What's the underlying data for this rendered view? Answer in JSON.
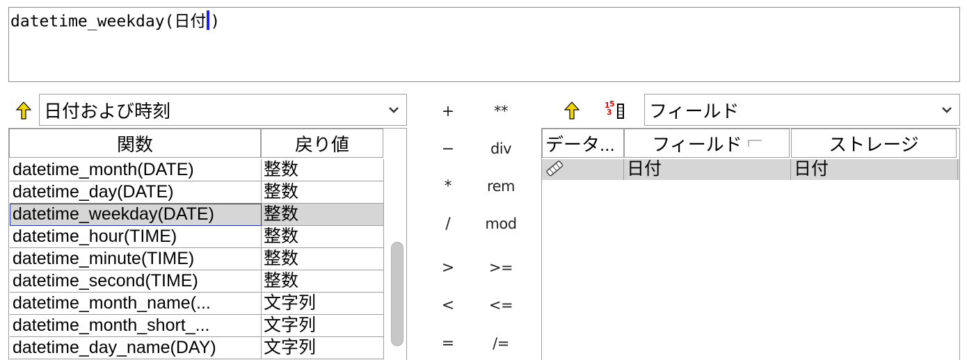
{
  "expression": {
    "text_before_caret": "datetime_weekday(日付",
    "text_after_caret": ")"
  },
  "function_panel": {
    "up_icon": "up-arrow-icon",
    "category_value": "日付および時刻",
    "dropdown_icon": "chevron-down-icon",
    "columns": [
      "関数",
      "戻り値"
    ],
    "rows": [
      {
        "function": "datetime_month(DATE)",
        "return": "整数"
      },
      {
        "function": "datetime_day(DATE)",
        "return": "整数"
      },
      {
        "function": "datetime_weekday(DATE)",
        "return": "整数",
        "selected": true
      },
      {
        "function": "datetime_hour(TIME)",
        "return": "整数"
      },
      {
        "function": "datetime_minute(TIME)",
        "return": "整数"
      },
      {
        "function": "datetime_second(TIME)",
        "return": "整数"
      },
      {
        "function": "datetime_month_name(...",
        "return": "文字列"
      },
      {
        "function": "datetime_month_short_...",
        "return": "文字列"
      },
      {
        "function": "datetime_day_name(DAY)",
        "return": "文字列"
      }
    ]
  },
  "operators": [
    [
      "+",
      "**"
    ],
    [
      "−",
      "div"
    ],
    [
      "*",
      "rem"
    ],
    [
      "/",
      "mod"
    ],
    [
      ">",
      ">="
    ],
    [
      "<",
      "<="
    ],
    [
      "=",
      "/="
    ]
  ],
  "field_panel": {
    "up_icon": "up-arrow-icon",
    "sort_icon": "numeric-sort-icon",
    "sort_icon_text": "15 3",
    "category_value": "フィールド",
    "dropdown_icon": "chevron-down-icon",
    "columns": [
      "データ...",
      "フィールド",
      "ストレージ"
    ],
    "rows": [
      {
        "type_icon": "date-field-icon",
        "field": "日付",
        "storage": "日付"
      }
    ]
  },
  "colors": {
    "caret": "#1c1cff",
    "selection": "#d6d6d6",
    "up_arrow": "#f2d600"
  }
}
